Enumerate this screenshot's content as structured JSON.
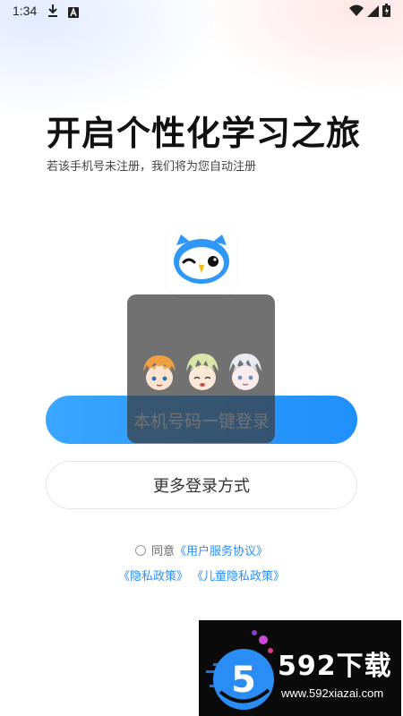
{
  "status_bar": {
    "time": "1:34",
    "icons": [
      "download-icon",
      "a-icon",
      "wifi-icon",
      "signal-icon",
      "battery-icon"
    ]
  },
  "header": {
    "title": "开启个性化学习之旅",
    "subtitle": "若该手机号未注册，我们将为您自动注册"
  },
  "app_icon": {
    "name": "owl-logo-icon"
  },
  "buttons": {
    "one_click_login": "本机号码一键登录",
    "more_login": "更多登录方式"
  },
  "agreement": {
    "prefix": "同意",
    "user_agreement": "《用户服务协议》",
    "privacy_policy": "《隐私政策》",
    "child_privacy_policy": "《儿童隐私政策》"
  },
  "watermark": {
    "brand": "592下载",
    "url": "www.592xiazai.com",
    "logo_digit": "5"
  },
  "colors": {
    "primary": "#2196F8",
    "link": "#2b8ef9",
    "overlay": "#3a3a3a"
  }
}
